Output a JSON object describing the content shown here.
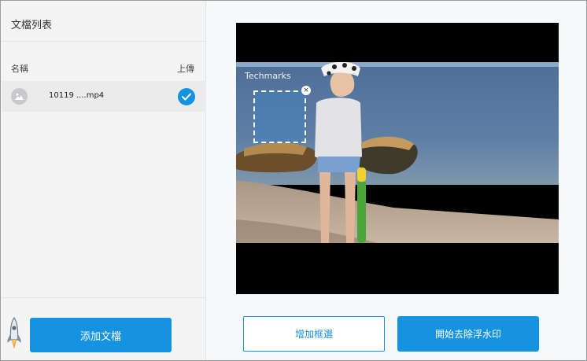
{
  "sidebar": {
    "title": "文檔列表",
    "columns": {
      "name": "名稱",
      "upload": "上傳"
    },
    "files": [
      {
        "name": "10119 ....mp4",
        "uploaded": true
      }
    ],
    "add_button_label": "添加文檔"
  },
  "preview": {
    "watermark_text": "Techmarks"
  },
  "actions": {
    "add_selection_label": "增加框選",
    "start_label": "開始去除浮水印"
  },
  "colors": {
    "accent": "#1592e0"
  },
  "icons": {
    "thumbnail": "image-placeholder-icon",
    "status": "check-circle-icon",
    "mascot": "rocket-icon",
    "close": "close-icon"
  }
}
